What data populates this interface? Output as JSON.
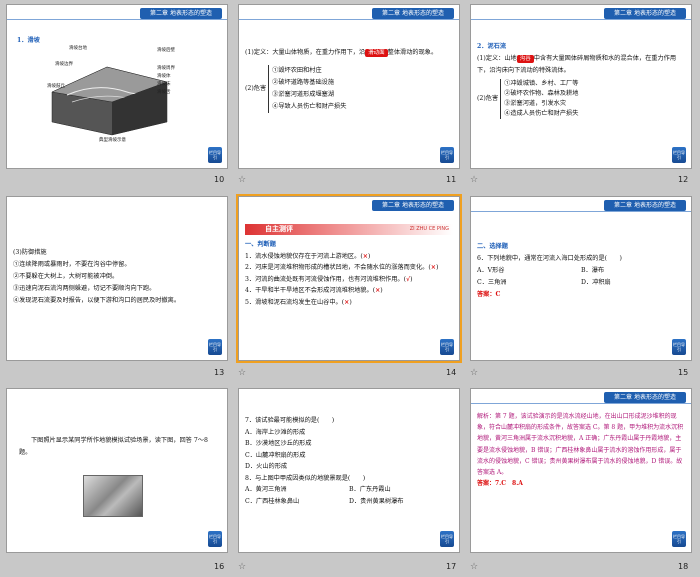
{
  "header_label": "第二章 地表形态的塑造",
  "nav_button_label": "栏目导引",
  "slides": [
    {
      "num": "10",
      "title": "1．滑坡",
      "diagram_labels": [
        "滑坡台地",
        "滑坡后壁",
        "滑坡边界",
        "滑坡周界",
        "滑坡体",
        "滑坡床",
        "滑坡舌",
        "滑坡鼓丘"
      ],
      "caption": "典型滑坡示意"
    },
    {
      "num": "11",
      "line1_a": "(1)定义：大量山体物质，在重力作用下，沿",
      "line1_blank": "滑动面",
      "line1_b": "整体滑动的现象。",
      "harm_label": "(2)危害",
      "harm_items": [
        "①毁坏农田和村庄",
        "②破坏道路等基础设施",
        "③淤塞河道形成堰塞湖",
        "④导致人员伤亡和财产损失"
      ]
    },
    {
      "num": "12",
      "title": "2．泥石流",
      "line1_a": "(1)定义：山地",
      "line1_blank": "沟谷",
      "line1_b": "中含有大量固体碎屑物质和水的混合体，在重力作用下，沿沟床向下流动的特殊流体。",
      "harm_label": "(2)危害",
      "harm_items": [
        "①冲毁城镇、乡村、工厂等",
        "②破坏农作物、森林及耕地",
        "③淤塞河道，引发水灾",
        "④造成人员伤亡和财产损失"
      ]
    },
    {
      "num": "13",
      "items": [
        "(3)防御措施",
        "①连续降雨或暴雨时，不要在沟谷中停留。",
        "②不要躲在大树上，大树可能被冲倒。",
        "③迅速向泥石流沟两侧躲避，切记不要顺沟向下跑。",
        "④发现泥石流要及时报告，以便下游和沟口的居民及时撤离。"
      ]
    },
    {
      "num": "14",
      "banner": "自主测评",
      "banner_pinyin": "ZI ZHU CE PING",
      "section": "一、判断题",
      "items": [
        {
          "text": "1．流水侵蚀地貌仅存在于河流上游地区。",
          "mark": "×"
        },
        {
          "text": "2．河床是河流堆积物形成的槽状凹地，不会随水位的涨落而变化。",
          "mark": "×"
        },
        {
          "text": "3．河流的曲流处既有河流侵蚀作用，也有河流堆积作用。",
          "mark": "√"
        },
        {
          "text": "4．干旱和半干旱地区不会形成河流堆积地貌。",
          "mark": "×"
        },
        {
          "text": "5．滑坡和泥石流均发生在山谷中。",
          "mark": "×"
        }
      ]
    },
    {
      "num": "15",
      "section": "二、选择题",
      "question": "6．下列地貌中，通常在河流入海口处形成的是(　　)",
      "options": [
        "A．V形谷",
        "B．瀑布",
        "C．三角洲",
        "D．冲积扇"
      ],
      "answer": "答案：C"
    },
    {
      "num": "16",
      "text": "下图照片显示某同学所作地貌模拟试验场景，读下图，回答 7～8 题。"
    },
    {
      "num": "17",
      "q7": "7．该试验最可能模拟的是(　　)",
      "q7_options": [
        "A．海岸上沙滩的形成",
        "B．沙漠地区沙丘的形成",
        "C．山麓冲积扇的形成",
        "D．火山的形成"
      ],
      "q8": "8．与上图中甲成因类似的地貌景观是(　　)",
      "q8_options": [
        "A．黄河三角洲",
        "B．广东丹霞山",
        "C．广西桂林象鼻山",
        "D．贵州黄果树瀑布"
      ]
    },
    {
      "num": "18",
      "text": "解析：第 7 题，该试验演示的是流水流经山地，在出山口形成泥沙堆积的现象，符合山麓冲积扇的形成条件，故答案选 C。第 8 题，甲为堆积为流水沉积地貌，黄河三角洲属于流水沉积地貌，A 正确；广东丹霞山属于丹霞地貌，主要是流水侵蚀地貌，B 错误；广西桂林象鼻山属于流水的溶蚀作用形成，属于流水的侵蚀地貌，C 错误；贵州黄果树瀑布属于流水的侵蚀地貌，D 错误。故答案选 A。",
      "answer": "答案：7.C　8.A"
    }
  ]
}
